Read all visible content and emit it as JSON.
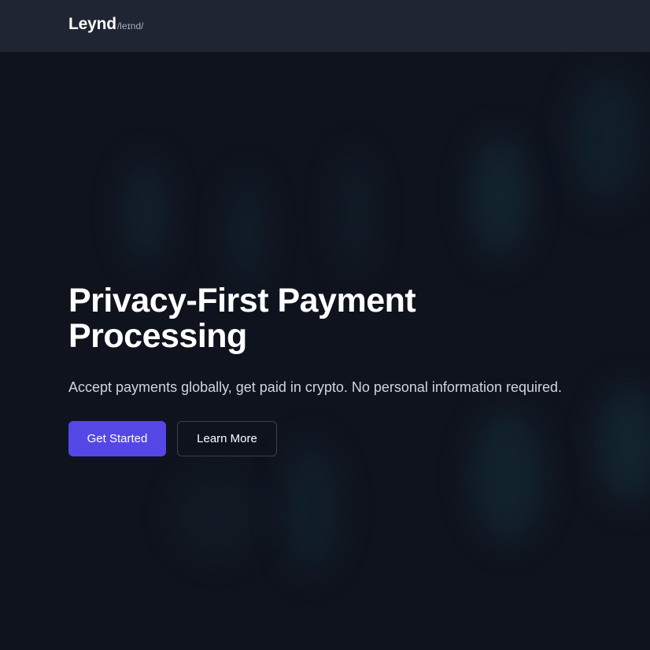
{
  "header": {
    "brand_name": "Leynd",
    "brand_phonetic": "/leɪnd/"
  },
  "hero": {
    "title_line1": "Privacy-First Payment",
    "title_line2": "Processing",
    "subtitle": "Accept payments globally, get paid in crypto. No personal information required.",
    "primary_button": "Get Started",
    "secondary_button": "Learn More"
  },
  "colors": {
    "background": "#0f131e",
    "navbar": "#1f2532",
    "accent": "#5447e6",
    "text_primary": "#ffffff",
    "text_secondary": "#d0d4dc"
  }
}
